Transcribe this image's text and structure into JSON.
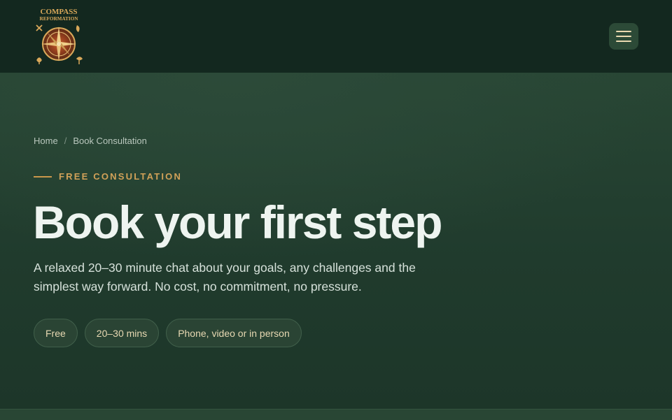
{
  "header": {
    "logo": {
      "text_line1": "COMPASS",
      "text_line2": "REFORMATION",
      "icon": "compass-rose-icon"
    },
    "menu_button": {
      "icon": "hamburger-menu-icon"
    }
  },
  "breadcrumb": {
    "items": [
      "Home",
      "Book Consultation"
    ],
    "separator": "/"
  },
  "hero": {
    "eyebrow": "FREE CONSULTATION",
    "title": "Book your first step",
    "lede": "A relaxed 20–30 minute chat about your goals, any challenges and the simplest way forward. No cost, no commitment, no pressure.",
    "pills": [
      "Free",
      "20–30 mins",
      "Phone, video or in person"
    ]
  },
  "colors": {
    "header_bg": "#13281f",
    "hero_bg": "#254232",
    "accent_gold": "#d1a158",
    "title_text": "#eef4f0",
    "pill_text": "#e7d8b2"
  }
}
